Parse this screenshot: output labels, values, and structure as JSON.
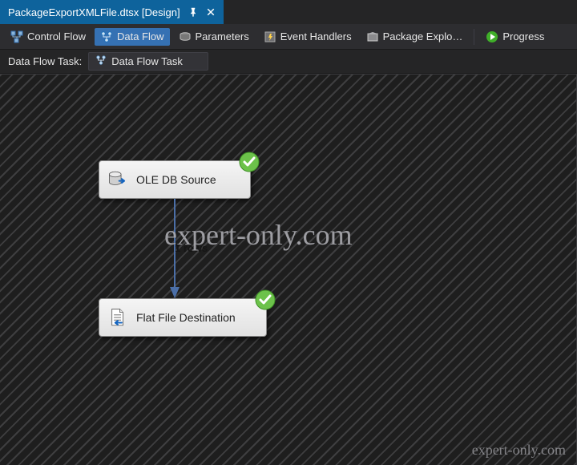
{
  "document_tab": {
    "title": "PackageExportXMLFile.dtsx [Design]",
    "pinned": true,
    "closable": true
  },
  "toolbar": {
    "items": [
      {
        "id": "control-flow",
        "label": "Control Flow",
        "icon": "control-flow-icon",
        "active": false
      },
      {
        "id": "data-flow",
        "label": "Data Flow",
        "icon": "data-flow-icon",
        "active": true
      },
      {
        "id": "parameters",
        "label": "Parameters",
        "icon": "parameters-icon",
        "active": false
      },
      {
        "id": "event-handlers",
        "label": "Event Handlers",
        "icon": "event-handlers-icon",
        "active": false
      },
      {
        "id": "package-explorer",
        "label": "Package Explo…",
        "icon": "package-explorer-icon",
        "active": false
      },
      {
        "id": "progress",
        "label": "Progress",
        "icon": "progress-icon",
        "active": false
      }
    ]
  },
  "taskbar": {
    "label": "Data Flow Task:",
    "selected": "Data Flow Task"
  },
  "nodes": {
    "source": {
      "label": "OLE DB Source",
      "status": "success"
    },
    "dest": {
      "label": "Flat File Destination",
      "status": "success"
    }
  },
  "connector": {
    "rows_label": "1 rows"
  },
  "watermark": {
    "big": "expert-only.com",
    "small": "expert-only.com"
  },
  "status_color_success": "#6cc24a"
}
